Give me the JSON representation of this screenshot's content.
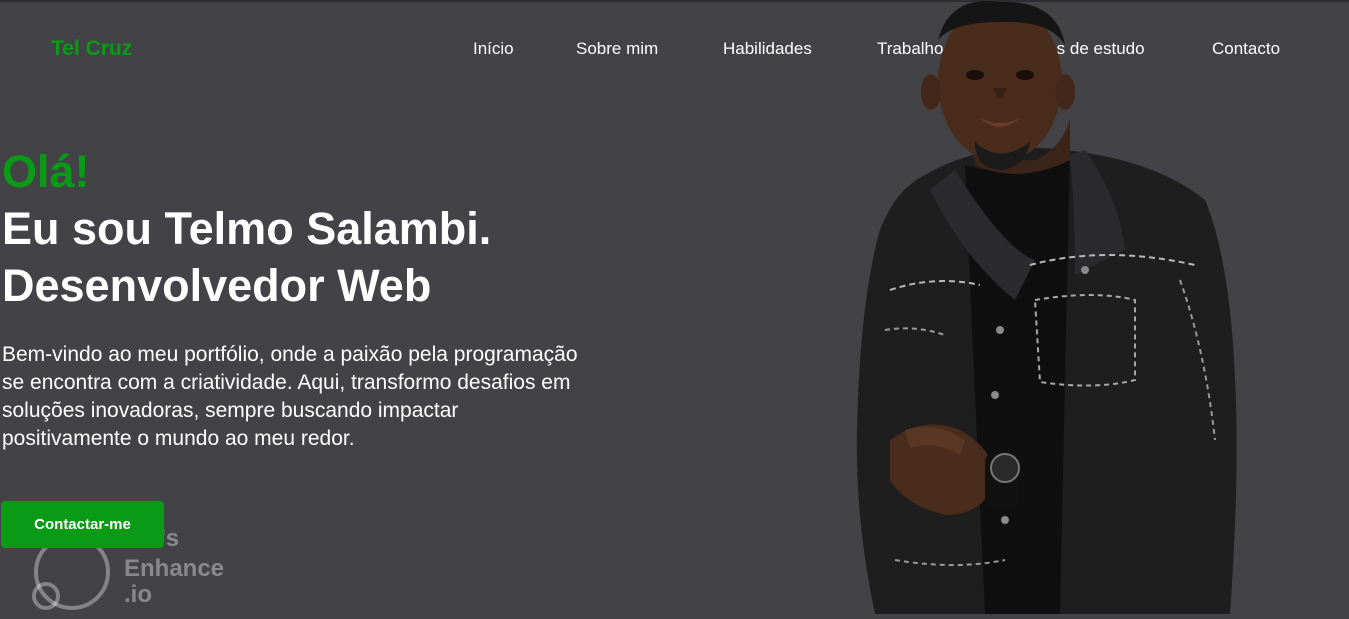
{
  "header": {
    "logo": "Tel Cruz",
    "nav": [
      {
        "label": "Início"
      },
      {
        "label": "Sobre mim"
      },
      {
        "label": "Habilidades"
      },
      {
        "label": "Trabalhos"
      },
      {
        "label": "Casos de estudo"
      },
      {
        "label": "Contacto"
      }
    ]
  },
  "hero": {
    "greeting": "Olá!",
    "line1": "Eu sou Telmo Salambi.",
    "line2": "Desenvolvedor Web",
    "description": "Bem-vindo ao meu portfólio, onde a paixão pela programação se encontra com a criatividade. Aqui, transformo desafios em soluções inovadoras, sempre buscando impactar positivamente o mundo ao meu redor.",
    "cta_label": "Contactar-me"
  },
  "watermark": {
    "line1": "Let's",
    "line2": "Enhance",
    "line3": ".io"
  },
  "colors": {
    "background": "#424247",
    "accent": "#0a9b16",
    "text": "#ffffff"
  },
  "icons": {
    "watermark_logo": "letsenhance-logo-icon"
  }
}
